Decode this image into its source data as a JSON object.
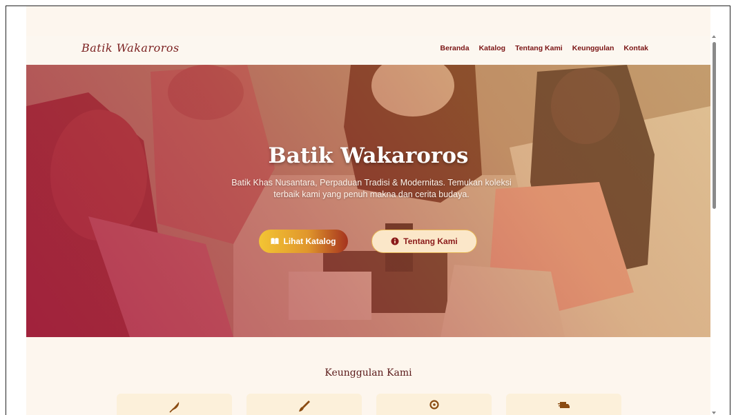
{
  "brand": {
    "logo_text": "Batik Wakaroros"
  },
  "nav": {
    "items": [
      {
        "label": "Beranda"
      },
      {
        "label": "Katalog"
      },
      {
        "label": "Tentang Kami"
      },
      {
        "label": "Keunggulan"
      },
      {
        "label": "Kontak"
      }
    ]
  },
  "hero": {
    "title": "Batik Wakaroros",
    "subtitle": "Batik Khas Nusantara, Perpaduan Tradisi & Modernitas. Temukan koleksi terbaik kami yang penuh makna dan cerita budaya.",
    "primary_button": {
      "label": "Lihat Katalog",
      "icon": "book-open-icon"
    },
    "secondary_button": {
      "label": "Tentang Kami",
      "icon": "info-circle-icon"
    }
  },
  "features": {
    "title": "Keunggulan Kami",
    "cards": [
      {
        "icon": "feather-icon"
      },
      {
        "icon": "paintbrush-icon"
      },
      {
        "icon": "map-pin-icon"
      },
      {
        "icon": "shipping-truck-icon"
      }
    ]
  },
  "colors": {
    "brand_maroon": "#7a1414",
    "accent_gold": "#e6b552",
    "page_background": "#fdf6ee"
  }
}
